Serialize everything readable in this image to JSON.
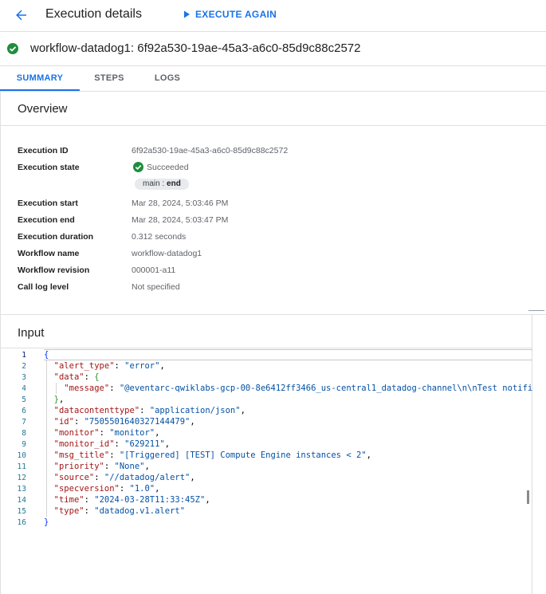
{
  "header": {
    "title": "Execution details",
    "execute_again_label": "EXECUTE AGAIN"
  },
  "execution_title": "workflow-datadog1: 6f92a530-19ae-45a3-a6c0-85d9c88c2572",
  "tabs": [
    {
      "label": "SUMMARY",
      "active": true
    },
    {
      "label": "STEPS",
      "active": false
    },
    {
      "label": "LOGS",
      "active": false
    }
  ],
  "overview": {
    "title": "Overview",
    "fields": [
      {
        "label": "Execution ID",
        "value": "6f92a530-19ae-45a3-a6c0-85d9c88c2572"
      },
      {
        "label": "Execution state",
        "value": "Succeeded"
      },
      {
        "label": "Execution start",
        "value": "Mar 28, 2024, 5:03:46 PM"
      },
      {
        "label": "Execution end",
        "value": "Mar 28, 2024, 5:03:47 PM"
      },
      {
        "label": "Execution duration",
        "value": "0.312 seconds"
      },
      {
        "label": "Workflow name",
        "value": "workflow-datadog1"
      },
      {
        "label": "Workflow revision",
        "value": "000001-a11"
      },
      {
        "label": "Call log level",
        "value": "Not specified"
      }
    ],
    "step_chip": {
      "subworkflow": "main",
      "separator": ":",
      "step": "end"
    }
  },
  "input": {
    "title": "Input",
    "line_numbers": [
      "1",
      "2",
      "3",
      "4",
      "5",
      "6",
      "7",
      "8",
      "9",
      "10",
      "11",
      "12",
      "13",
      "14",
      "15",
      "16"
    ],
    "json": {
      "open_brace": "{",
      "close_brace": "}",
      "alert_type_key": "\"alert_type\"",
      "alert_type_value": "\"error\"",
      "data_key": "\"data\"",
      "data_open": "{",
      "data_close": "}",
      "message_key": "\"message\"",
      "message_value": "\"@eventarc-qwiklabs-gcp-00-8e6412ff3466_us-central1_datadog-channel\\n\\nTest notifi",
      "datacontenttype_key": "\"datacontenttype\"",
      "datacontenttype_value": "\"application/json\"",
      "id_key": "\"id\"",
      "id_value": "\"7505501640327144479\"",
      "monitor_key": "\"monitor\"",
      "monitor_value": "\"monitor\"",
      "monitor_id_key": "\"monitor_id\"",
      "monitor_id_value": "\"629211\"",
      "msg_title_key": "\"msg_title\"",
      "msg_title_value": "\"[Triggered] [TEST] Compute Engine instances < 2\"",
      "priority_key": "\"priority\"",
      "priority_value": "\"None\"",
      "source_key": "\"source\"",
      "source_value": "\"//datadog/alert\"",
      "specversion_key": "\"specversion\"",
      "specversion_value": "\"1.0\"",
      "time_key": "\"time\"",
      "time_value": "\"2024-03-28T11:33:45Z\"",
      "type_key": "\"type\"",
      "type_value": "\"datadog.v1.alert\""
    }
  },
  "colors": {
    "accent": "#1a73e8",
    "success": "#1e8e3e",
    "json_key": "#a31515",
    "json_string": "#0451a5",
    "line_number": "#237893"
  }
}
